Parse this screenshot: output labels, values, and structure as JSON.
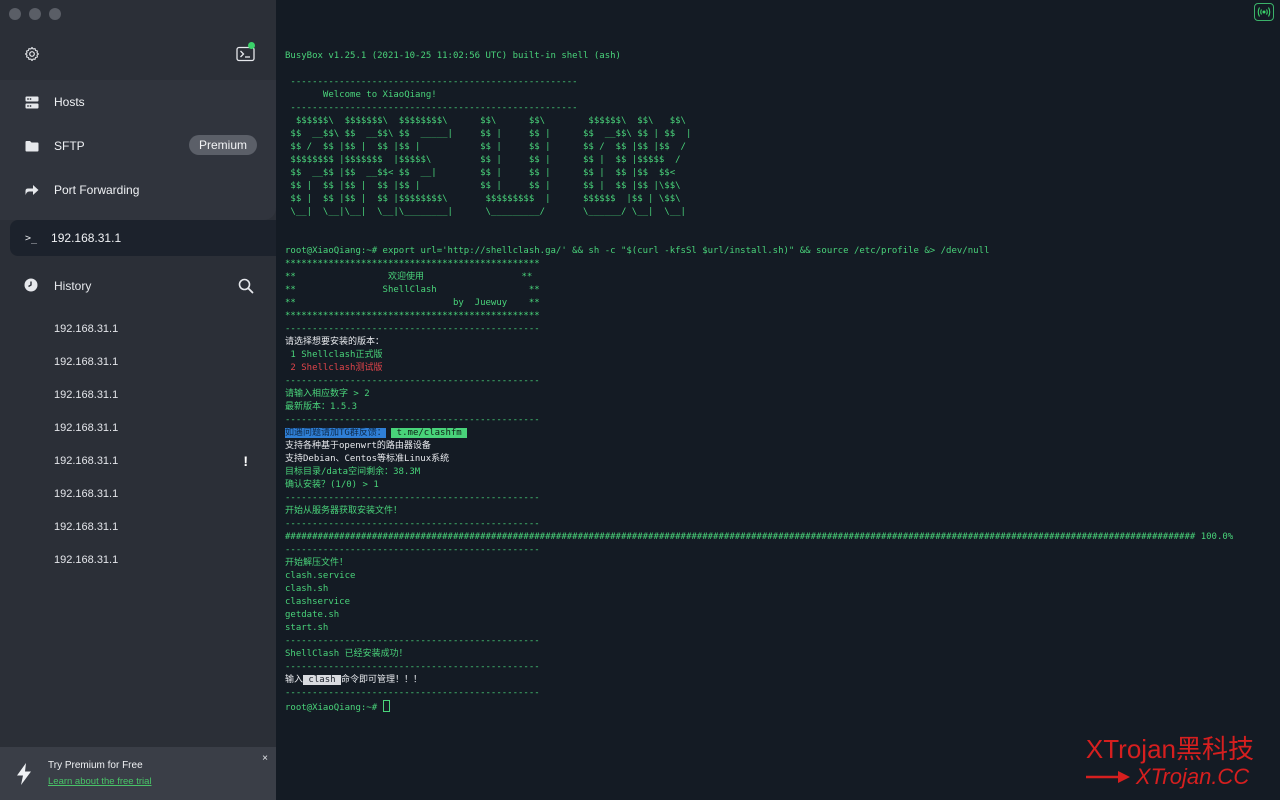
{
  "sidebar": {
    "nav": [
      {
        "label": "Hosts",
        "icon": "hosts-icon"
      },
      {
        "label": "SFTP",
        "icon": "folder-icon",
        "badge": "Premium"
      },
      {
        "label": "Port Forwarding",
        "icon": "forward-arrow-icon"
      }
    ],
    "active_session": {
      "prompt": ">_",
      "label": "192.168.31.1"
    },
    "history": {
      "title": "History",
      "items": [
        {
          "label": "192.168.31.1",
          "flag": ""
        },
        {
          "label": "192.168.31.1",
          "flag": ""
        },
        {
          "label": "192.168.31.1",
          "flag": ""
        },
        {
          "label": "192.168.31.1",
          "flag": ""
        },
        {
          "label": "192.168.31.1",
          "flag": "!"
        },
        {
          "label": "192.168.31.1",
          "flag": ""
        },
        {
          "label": "192.168.31.1",
          "flag": ""
        },
        {
          "label": "192.168.31.1",
          "flag": ""
        }
      ]
    },
    "promo": {
      "title": "Try Premium for Free",
      "link": "Learn about the free trial",
      "close": "×"
    }
  },
  "terminal": {
    "lines": [
      [
        {
          "t": "BusyBox v1.25.1 (2021-10-25 11:02:56 UTC) built-in shell (ash)"
        }
      ],
      [
        {
          "t": ""
        }
      ],
      [
        {
          "t": " -----------------------------------------------------"
        }
      ],
      [
        {
          "t": "       Welcome to XiaoQiang!"
        }
      ],
      [
        {
          "t": " -----------------------------------------------------"
        }
      ],
      [
        {
          "t": "  $$$$$$\\  $$$$$$$\\  $$$$$$$$\\      $$\\      $$\\        $$$$$$\\  $$\\   $$\\"
        }
      ],
      [
        {
          "t": " $$  __$$\\ $$  __$$\\ $$  _____|     $$ |     $$ |      $$  __$$\\ $$ | $$  |"
        }
      ],
      [
        {
          "t": " $$ /  $$ |$$ |  $$ |$$ |           $$ |     $$ |      $$ /  $$ |$$ |$$  /"
        }
      ],
      [
        {
          "t": " $$$$$$$$ |$$$$$$$  |$$$$$\\         $$ |     $$ |      $$ |  $$ |$$$$$  /"
        }
      ],
      [
        {
          "t": " $$  __$$ |$$  __$$< $$  __|        $$ |     $$ |      $$ |  $$ |$$  $$<"
        }
      ],
      [
        {
          "t": " $$ |  $$ |$$ |  $$ |$$ |           $$ |     $$ |      $$ |  $$ |$$ |\\$$\\"
        }
      ],
      [
        {
          "t": " $$ |  $$ |$$ |  $$ |$$$$$$$$\\       $$$$$$$$$  |      $$$$$$  |$$ | \\$$\\"
        }
      ],
      [
        {
          "t": " \\__|  \\__|\\__|  \\__|\\________|      \\_________/       \\______/ \\__|  \\__|"
        }
      ],
      [
        {
          "t": ""
        }
      ],
      [
        {
          "t": ""
        }
      ],
      [
        {
          "t": "root@XiaoQiang:~# export url='http://shellclash.ga/' && sh -c \"$(curl -kfsSl $url/install.sh)\" && source /etc/profile &> /dev/null"
        }
      ],
      [
        {
          "t": "***********************************************"
        }
      ],
      [
        {
          "t": "**                 欢迎使用                  **"
        }
      ],
      [
        {
          "t": "**                ShellClash                 **"
        }
      ],
      [
        {
          "t": "**                             by  Juewuy    **"
        }
      ],
      [
        {
          "t": "***********************************************"
        }
      ],
      [
        {
          "t": "-----------------------------------------------"
        }
      ],
      [
        {
          "t": "请选择想要安装的版本：",
          "c": "white"
        }
      ],
      [
        {
          "t": " 1 Shellclash正式版"
        }
      ],
      [
        {
          "t": " 2 Shellclash测试版",
          "c": "red"
        }
      ],
      [
        {
          "t": "-----------------------------------------------"
        }
      ],
      [
        {
          "t": "请输入相应数字 > 2"
        }
      ],
      [
        {
          "t": "最新版本：1.5.3"
        }
      ],
      [
        {
          "t": "-----------------------------------------------"
        }
      ],
      [
        {
          "t": "如遇问题请加TG群反馈：",
          "hl": "blue"
        },
        {
          "t": " "
        },
        {
          "t": " t.me/clashfm ",
          "hl": "green"
        }
      ],
      [
        {
          "t": "支持各种基于openwrt的路由器设备",
          "c": "white"
        }
      ],
      [
        {
          "t": "支持Debian、Centos等标准Linux系统",
          "c": "white"
        }
      ],
      [
        {
          "t": "目标目录/data空间剩余：38.3M"
        }
      ],
      [
        {
          "t": "确认安装？(1/0) > 1"
        }
      ],
      [
        {
          "t": "-----------------------------------------------"
        }
      ],
      [
        {
          "t": "开始从服务器获取安装文件！"
        }
      ],
      [
        {
          "t": "-----------------------------------------------"
        }
      ],
      [
        {
          "t": "######################################################################################################################################################################## 100.0%"
        }
      ],
      [
        {
          "t": "-----------------------------------------------"
        }
      ],
      [
        {
          "t": "开始解压文件！"
        }
      ],
      [
        {
          "t": "clash.service"
        }
      ],
      [
        {
          "t": "clash.sh"
        }
      ],
      [
        {
          "t": "clashservice"
        }
      ],
      [
        {
          "t": "getdate.sh"
        }
      ],
      [
        {
          "t": "start.sh"
        }
      ],
      [
        {
          "t": "-----------------------------------------------"
        }
      ],
      [
        {
          "t": "ShellClash 已经安装成功！"
        }
      ],
      [
        {
          "t": "-----------------------------------------------"
        }
      ],
      [
        {
          "t": "输入",
          "c": "white"
        },
        {
          "t": " clash ",
          "hl": "white"
        },
        {
          "t": "命令即可管理！！！",
          "c": "white"
        }
      ],
      [
        {
          "t": "-----------------------------------------------"
        }
      ],
      [
        {
          "t": "root@XiaoQiang:~# "
        },
        {
          "t": "",
          "cursor": true
        }
      ]
    ]
  },
  "watermark": {
    "line1": "XTrojan黑科技",
    "line2": "XTrojan.CC"
  },
  "colors": {
    "terminal_green": "#49d37a",
    "sidebar_bg": "#2b2f37",
    "terminal_bg": "#141b24",
    "accent": "#3bd26a"
  }
}
